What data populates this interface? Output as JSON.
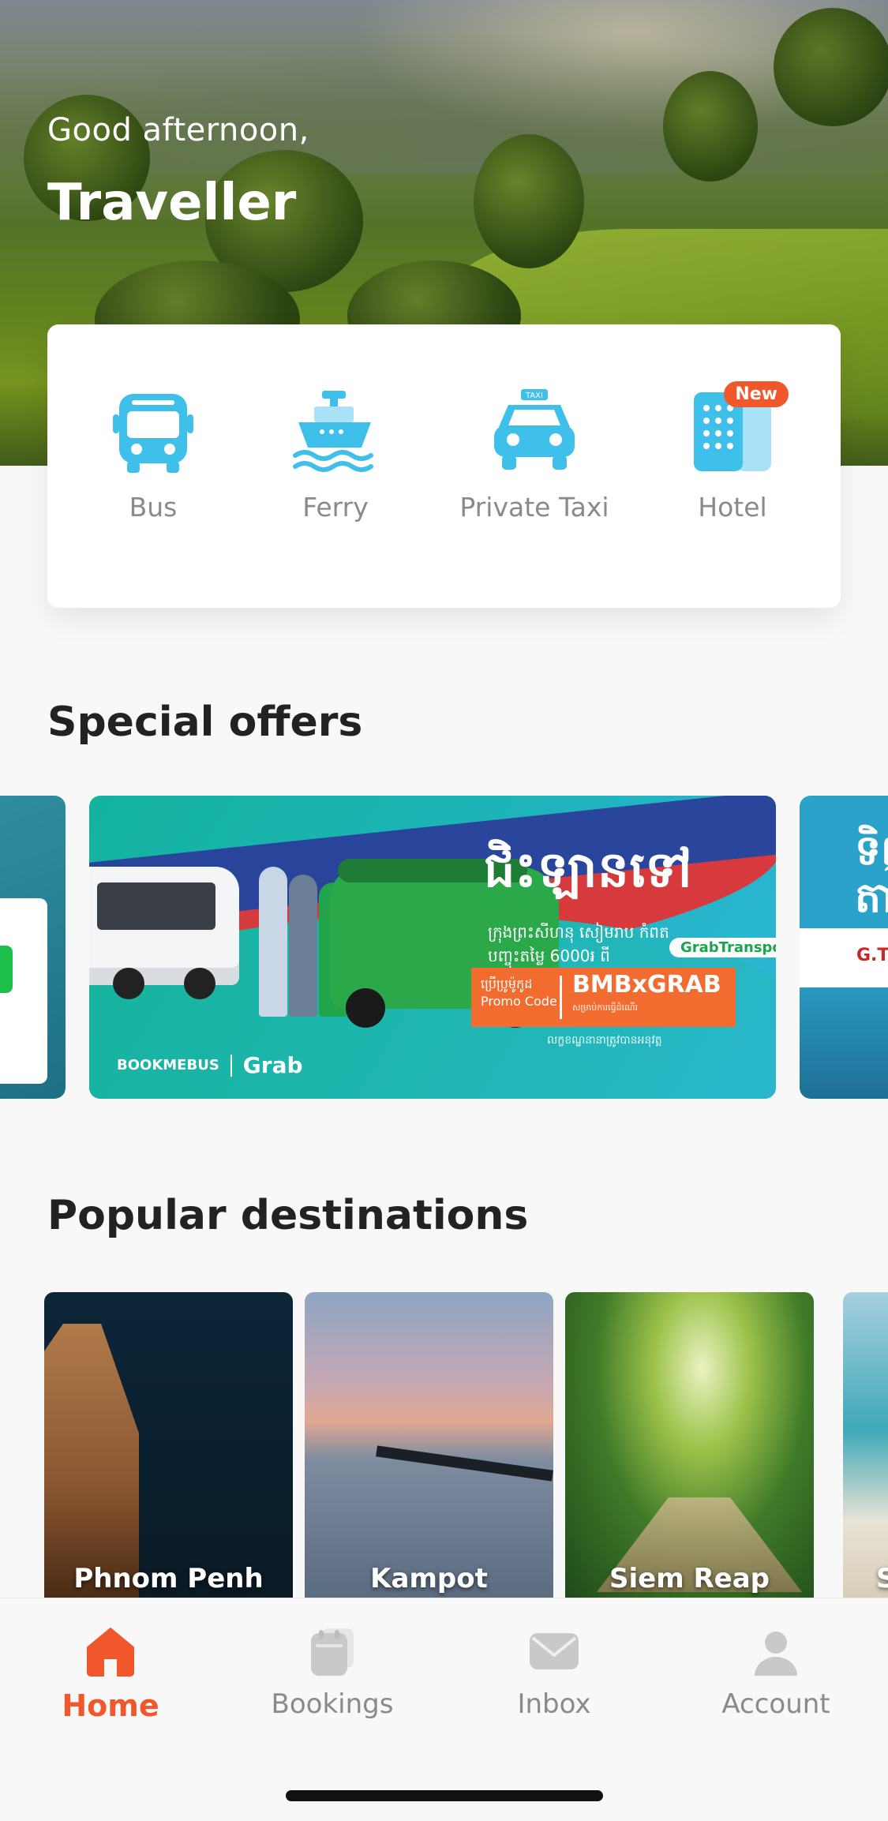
{
  "header": {
    "greeting": "Good afternoon,",
    "username": "Traveller"
  },
  "services": [
    {
      "label": "Bus",
      "icon": "bus-icon"
    },
    {
      "label": "Ferry",
      "icon": "ferry-icon"
    },
    {
      "label": "Private Taxi",
      "icon": "taxi-icon",
      "icon_text": "TAXI"
    },
    {
      "label": "Hotel",
      "icon": "hotel-icon",
      "badge": "New"
    }
  ],
  "special_offers": {
    "title": "Special offers",
    "main_banner": {
      "headline": "ជិះឡានទៅ",
      "subline": "ក្រុងព្រះសីហនុ សៀមរាប កំពត",
      "subline2": "បញ្ចុះតម្លៃ 6000៛ ពី",
      "partner_pill": "GrabTransport",
      "promo_label_km": "ប្រើប្រូម៉ូកូដ",
      "promo_label_en": "Promo Code",
      "promo_code": "BMBxGRAB",
      "promo_fine": "សម្រាប់ការធ្វើដំណើរ",
      "footer": "លក្ខខណ្ឌនានាត្រូវបានអនុវត្ត",
      "brand_left": "BOOKMEBUS",
      "brand_right": "Grab"
    },
    "right_banner_text": "ទិញ\nតាម",
    "right_banner_logo": "G.T."
  },
  "popular_destinations": {
    "title": "Popular destinations",
    "items": [
      {
        "name": "Phnom Penh"
      },
      {
        "name": "Kampot"
      },
      {
        "name": "Siem Reap"
      },
      {
        "name": "S"
      }
    ]
  },
  "bottom_nav": [
    {
      "label": "Home",
      "icon": "home-icon",
      "active": true
    },
    {
      "label": "Bookings",
      "icon": "bookings-icon",
      "active": false
    },
    {
      "label": "Inbox",
      "icon": "inbox-icon",
      "active": false
    },
    {
      "label": "Account",
      "icon": "account-icon",
      "active": false
    }
  ],
  "colors": {
    "accent": "#f0582b",
    "service_icon": "#3ec0ea",
    "service_icon_light": "#a9e2f6",
    "inactive": "#8a8a8a"
  }
}
